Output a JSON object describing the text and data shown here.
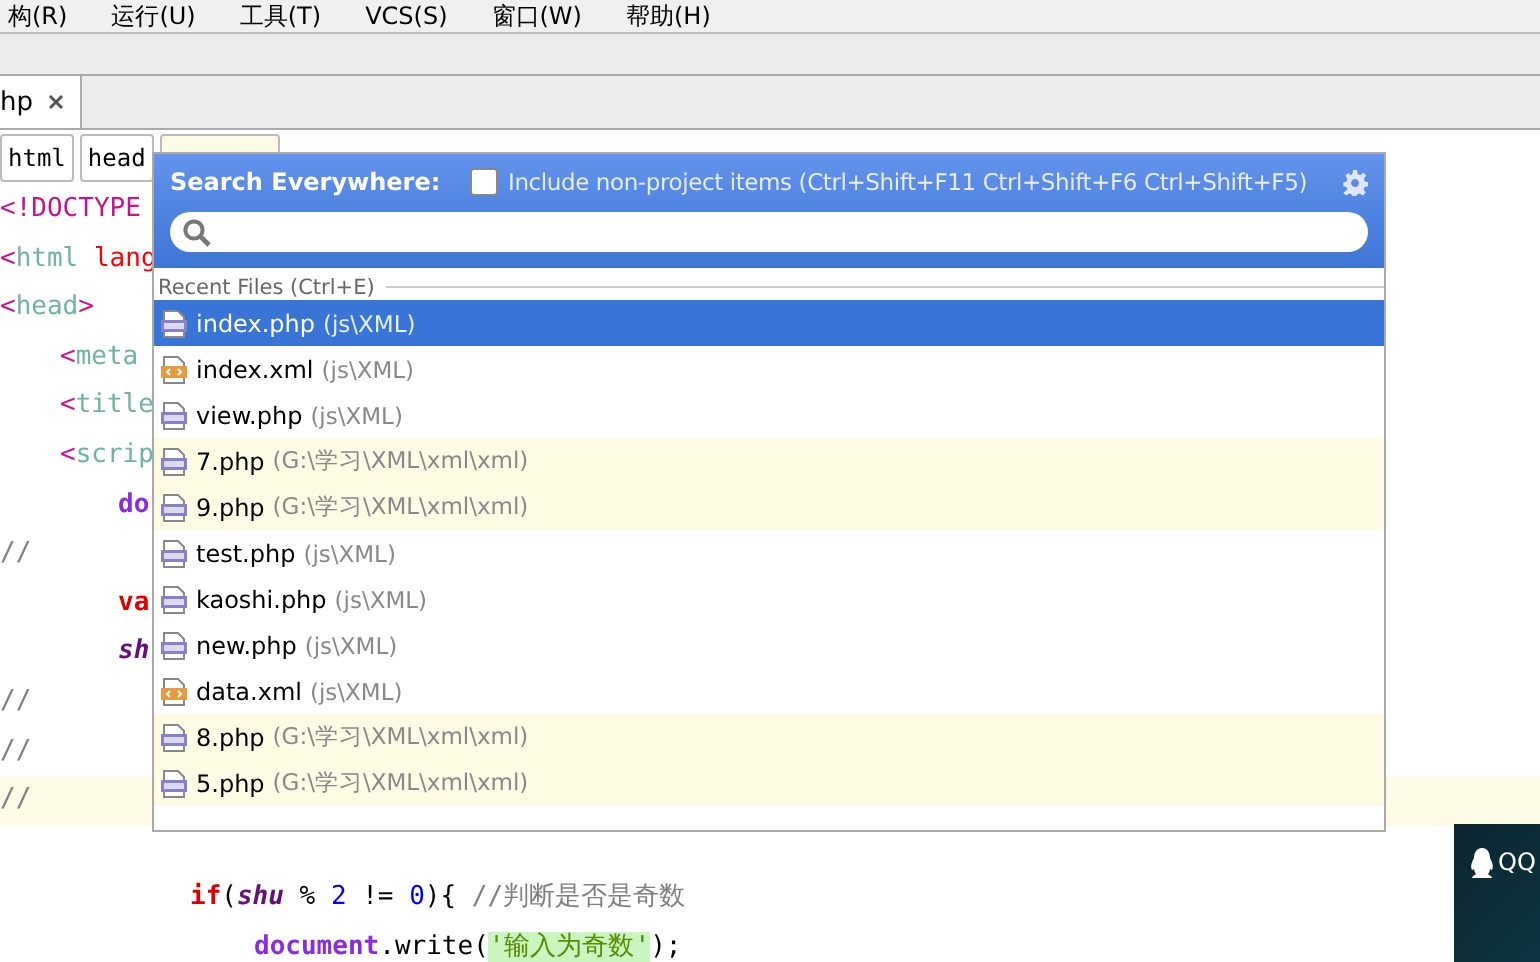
{
  "menu": [
    "构(R)",
    "运行(U)",
    "工具(T)",
    "VCS(S)",
    "窗口(W)",
    "帮助(H)"
  ],
  "editor_tabs": [
    {
      "label": "hp",
      "selected": true
    }
  ],
  "breadcrumbs": [
    {
      "label": "html",
      "selected": false
    },
    {
      "label": "head",
      "selected": false
    },
    {
      "selected": true
    }
  ],
  "code": [
    {
      "kind": "top",
      "current": false,
      "tokens": [
        {
          "kind": "tag",
          "text": "<!DOCTYPE"
        }
      ]
    },
    {
      "kind": "top",
      "current": false,
      "tokens": [
        {
          "kind": "tag",
          "text": "<"
        },
        {
          "kind": "tagname",
          "text": "html"
        },
        {
          "kind": "attr",
          "text": " lang"
        }
      ]
    },
    {
      "kind": "top",
      "current": false,
      "tokens": [
        {
          "kind": "tag",
          "text": "<"
        },
        {
          "kind": "tagname",
          "text": "head"
        },
        {
          "kind": "tag",
          "text": ">"
        }
      ]
    },
    {
      "kind": "inner",
      "current": false,
      "tokens": [
        {
          "kind": "tag",
          "text": "<"
        },
        {
          "kind": "tagname",
          "text": "meta"
        }
      ]
    },
    {
      "kind": "inner",
      "current": false,
      "tokens": [
        {
          "kind": "tag",
          "text": "<"
        },
        {
          "kind": "tagname",
          "text": "title"
        }
      ]
    },
    {
      "kind": "inner",
      "current": false,
      "tokens": [
        {
          "kind": "tag",
          "text": "<"
        },
        {
          "kind": "tagname",
          "text": "scrip"
        }
      ]
    },
    {
      "kind": "script",
      "current": false,
      "tokens": [
        {
          "kind": "func",
          "text": "do"
        }
      ]
    },
    {
      "kind": "top",
      "current": false,
      "tokens": [
        {
          "kind": "comment",
          "text": "//"
        }
      ]
    },
    {
      "kind": "script",
      "current": false,
      "tokens": [
        {
          "kind": "keyword",
          "text": "va"
        }
      ]
    },
    {
      "kind": "script",
      "current": false,
      "tokens": [
        {
          "kind": "var",
          "text": "sh"
        }
      ]
    },
    {
      "kind": "top",
      "current": false,
      "tokens": [
        {
          "kind": "comment",
          "text": "//"
        }
      ]
    },
    {
      "kind": "top",
      "current": false,
      "tokens": [
        {
          "kind": "comment",
          "text": "//"
        }
      ]
    },
    {
      "kind": "top",
      "current": true,
      "tokens": [
        {
          "kind": "comment",
          "text": "//"
        }
      ]
    },
    {
      "kind": "blank",
      "current": false
    },
    {
      "kind": "block",
      "current": false,
      "tokens": [
        {
          "kind": "keyword",
          "text": "if"
        },
        {
          "kind": "punct",
          "text": "("
        },
        {
          "kind": "var",
          "text": "shu"
        },
        {
          "kind": "punct",
          "text": " % "
        },
        {
          "kind": "number",
          "text": "2"
        },
        {
          "kind": "punct",
          "text": " != "
        },
        {
          "kind": "number",
          "text": "0"
        },
        {
          "kind": "punct",
          "text": "){ "
        },
        {
          "kind": "comment",
          "text": "//判断是否是奇数"
        }
      ]
    },
    {
      "kind": "body",
      "current": false,
      "tokens": [
        {
          "kind": "func",
          "text": "document"
        },
        {
          "kind": "punct",
          "text": ".write("
        },
        {
          "kind": "string",
          "text": "'输入为奇数'"
        },
        {
          "kind": "punct",
          "text": ");"
        }
      ]
    }
  ],
  "search_popup": {
    "title": "Search Everywhere:",
    "include_non_project": {
      "label": "Include non-project items (Ctrl+Shift+F11 Ctrl+Shift+F6 Ctrl+Shift+F5)",
      "checked": false
    },
    "section": "Recent Files (Ctrl+E)",
    "files": [
      {
        "name": "index.php",
        "path": "(js\\XML)",
        "kind": "php",
        "non_project": false,
        "selected": true
      },
      {
        "name": "index.xml",
        "path": "(js\\XML)",
        "kind": "xml",
        "non_project": false,
        "selected": false
      },
      {
        "name": "view.php",
        "path": "(js\\XML)",
        "kind": "php",
        "non_project": false,
        "selected": false
      },
      {
        "name": "7.php",
        "path": "(G:\\学习\\XML\\xml\\xml)",
        "kind": "php",
        "non_project": true,
        "selected": false
      },
      {
        "name": "9.php",
        "path": "(G:\\学习\\XML\\xml\\xml)",
        "kind": "php",
        "non_project": true,
        "selected": false
      },
      {
        "name": "test.php",
        "path": "(js\\XML)",
        "kind": "php",
        "non_project": false,
        "selected": false
      },
      {
        "name": "kaoshi.php",
        "path": "(js\\XML)",
        "kind": "php",
        "non_project": false,
        "selected": false
      },
      {
        "name": "new.php",
        "path": "(js\\XML)",
        "kind": "php",
        "non_project": false,
        "selected": false
      },
      {
        "name": "data.xml",
        "path": "(js\\XML)",
        "kind": "xml",
        "non_project": false,
        "selected": false
      },
      {
        "name": "8.php",
        "path": "(G:\\学习\\XML\\xml\\xml)",
        "kind": "php",
        "non_project": true,
        "selected": false
      },
      {
        "name": "5.php",
        "path": "(G:\\学习\\XML\\xml\\xml)",
        "kind": "php",
        "non_project": true,
        "selected": false
      }
    ]
  },
  "qq_panel": {
    "label": "QQ"
  }
}
